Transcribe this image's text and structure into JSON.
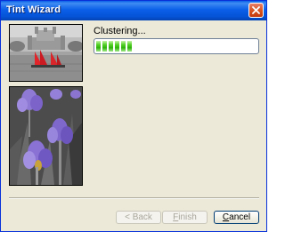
{
  "window": {
    "title": "Tint Wizard"
  },
  "icons": {
    "close": "close-icon"
  },
  "main": {
    "status_text": "Clustering...",
    "progress_fraction": 0.2,
    "progress_segments_filled": 6
  },
  "buttons": {
    "back": {
      "arrow": "<",
      "label": "Back",
      "enabled": false
    },
    "finish": {
      "prefix": "F",
      "suffix": "inish",
      "enabled": false
    },
    "cancel": {
      "prefix": "C",
      "suffix": "ancel",
      "enabled": true
    }
  },
  "colors": {
    "titlebar": "#0a5fe8",
    "progress_fill": "#2fb40b",
    "window_bg": "#ece9d8",
    "tint_purple": "#8f7ad6",
    "tint_red": "#e0242a"
  }
}
